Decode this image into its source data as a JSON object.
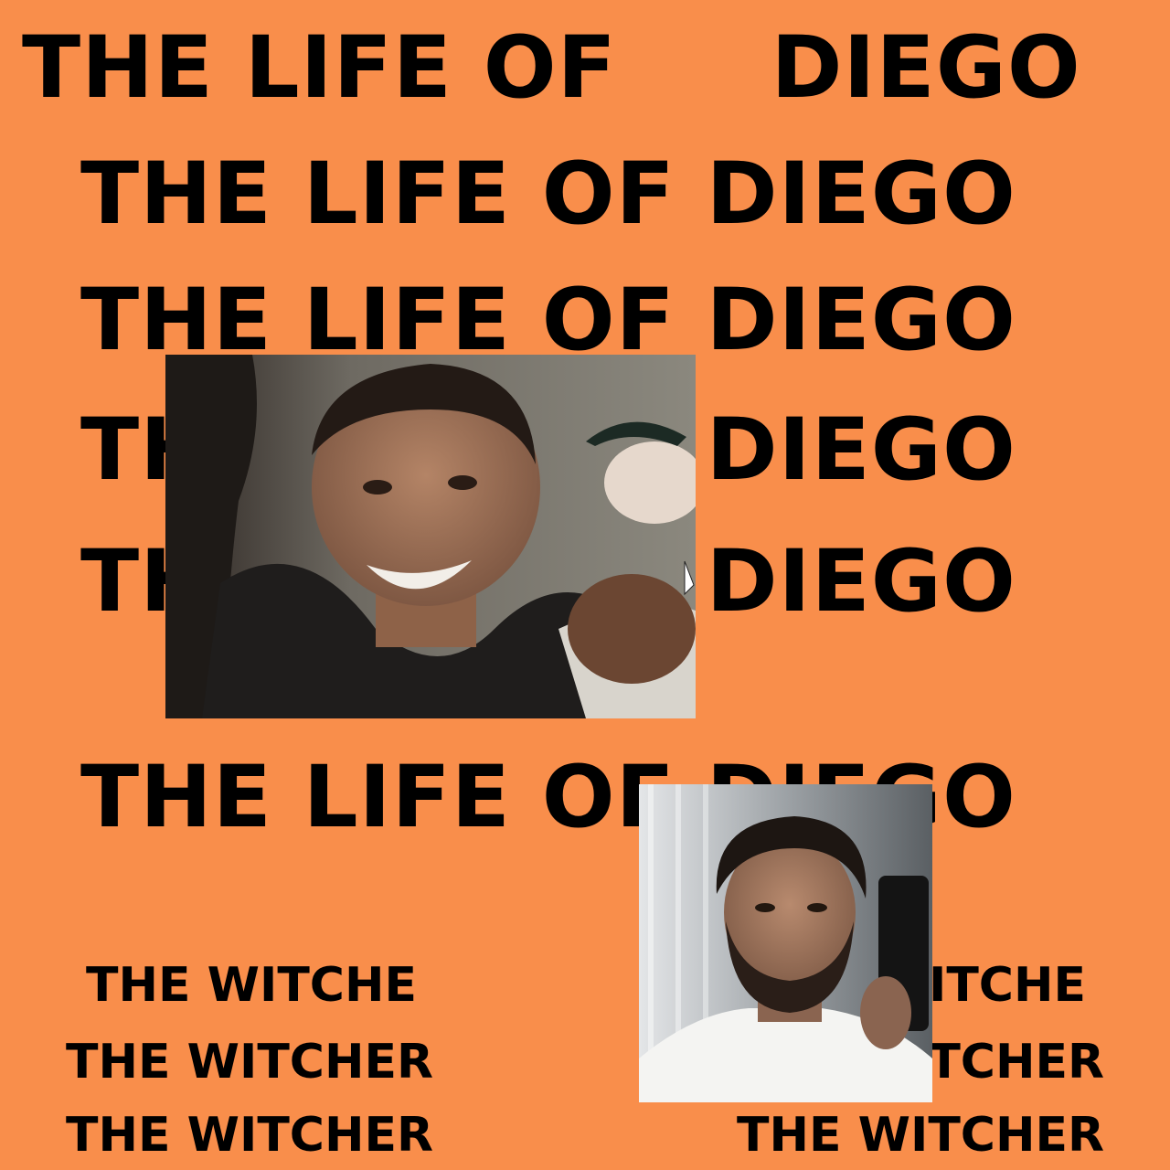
{
  "background_color": "#f98e4b",
  "text_color": "#000000",
  "title_lines": [
    "THE LIFE OF     DIEGO",
    "THE LIFE OF DIEGO",
    "THE LIFE OF DIEGO",
    "THE LIFE OF DIEGO",
    "THE LIFE OF DIEGO",
    "THE LIFE OF DIEGO"
  ],
  "left_lines": [
    "THE WITCHE",
    "THE WITCHER",
    "THE WITCHER"
  ],
  "right_lines": [
    "THE WITCHE",
    "THE WITCHER",
    "THE WITCHER"
  ],
  "photos": [
    {
      "name": "smiling-teen-photo"
    },
    {
      "name": "bearded-man-selfie-photo"
    }
  ]
}
